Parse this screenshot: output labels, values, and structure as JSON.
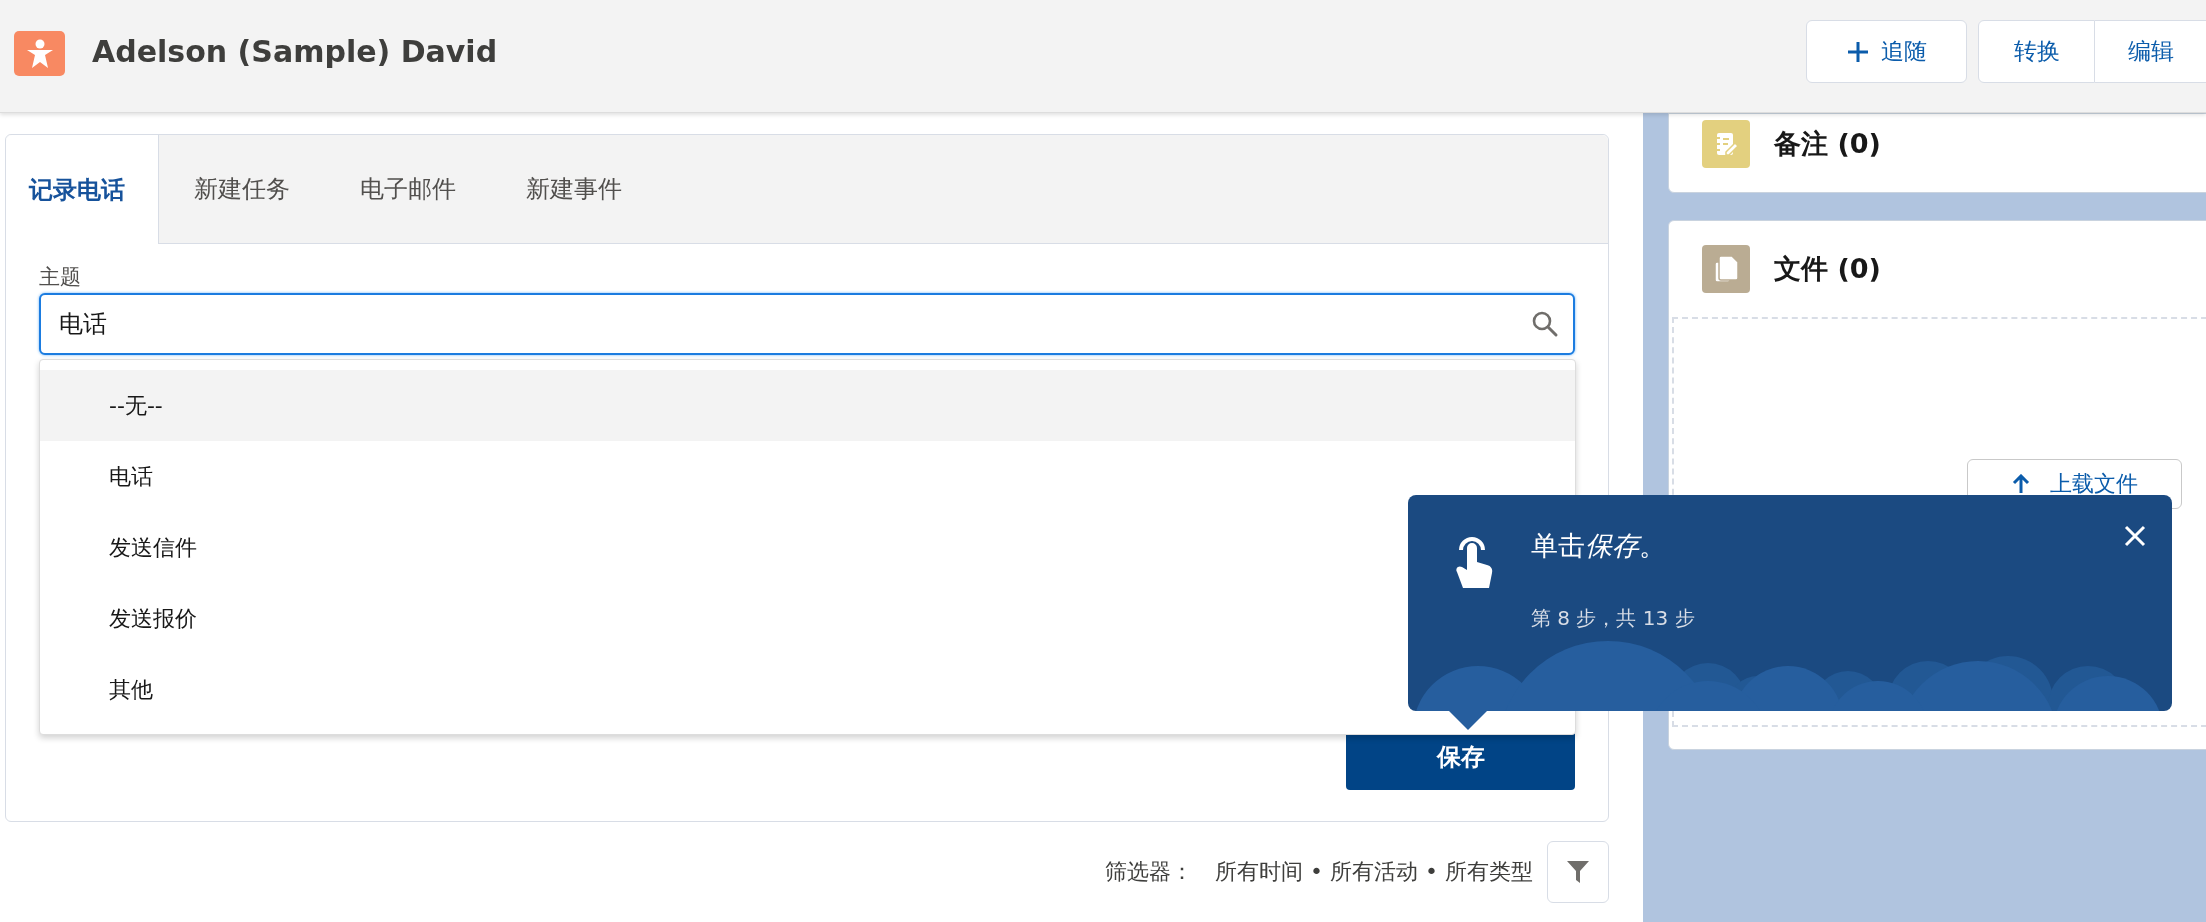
{
  "header": {
    "title": "Adelson (Sample) David",
    "actions": [
      {
        "label": "追随",
        "kind": "follow"
      },
      {
        "label": "转换",
        "kind": "grouped"
      },
      {
        "label": "编辑",
        "kind": "grouped"
      }
    ]
  },
  "tabs": [
    {
      "label": "记录电话",
      "selected": true
    },
    {
      "label": "新建任务",
      "selected": false
    },
    {
      "label": "电子邮件",
      "selected": false
    },
    {
      "label": "新建事件",
      "selected": false
    }
  ],
  "form": {
    "subject_label": "主题",
    "subject_value": "电话",
    "options": [
      {
        "label": "--无--",
        "selected": true
      },
      {
        "label": "电话",
        "selected": false
      },
      {
        "label": "发送信件",
        "selected": false
      },
      {
        "label": "发送报价",
        "selected": false
      },
      {
        "label": "其他",
        "selected": false
      }
    ],
    "save_button": "保存"
  },
  "filter": {
    "label": "筛选器：",
    "value": "所有时间 • 所有活动 • 所有类型"
  },
  "side_cards": [
    {
      "title": "备注 (0)",
      "kind": "notes"
    },
    {
      "title": "文件 (0)",
      "kind": "files",
      "upload_button": "上载文件"
    }
  ],
  "tooltip": {
    "title_runs": [
      {
        "text": "单击",
        "italic": false
      },
      {
        "text": "保存",
        "italic": true
      },
      {
        "text": "。",
        "italic": false
      }
    ],
    "step": "第 8 步，共 13 步"
  }
}
